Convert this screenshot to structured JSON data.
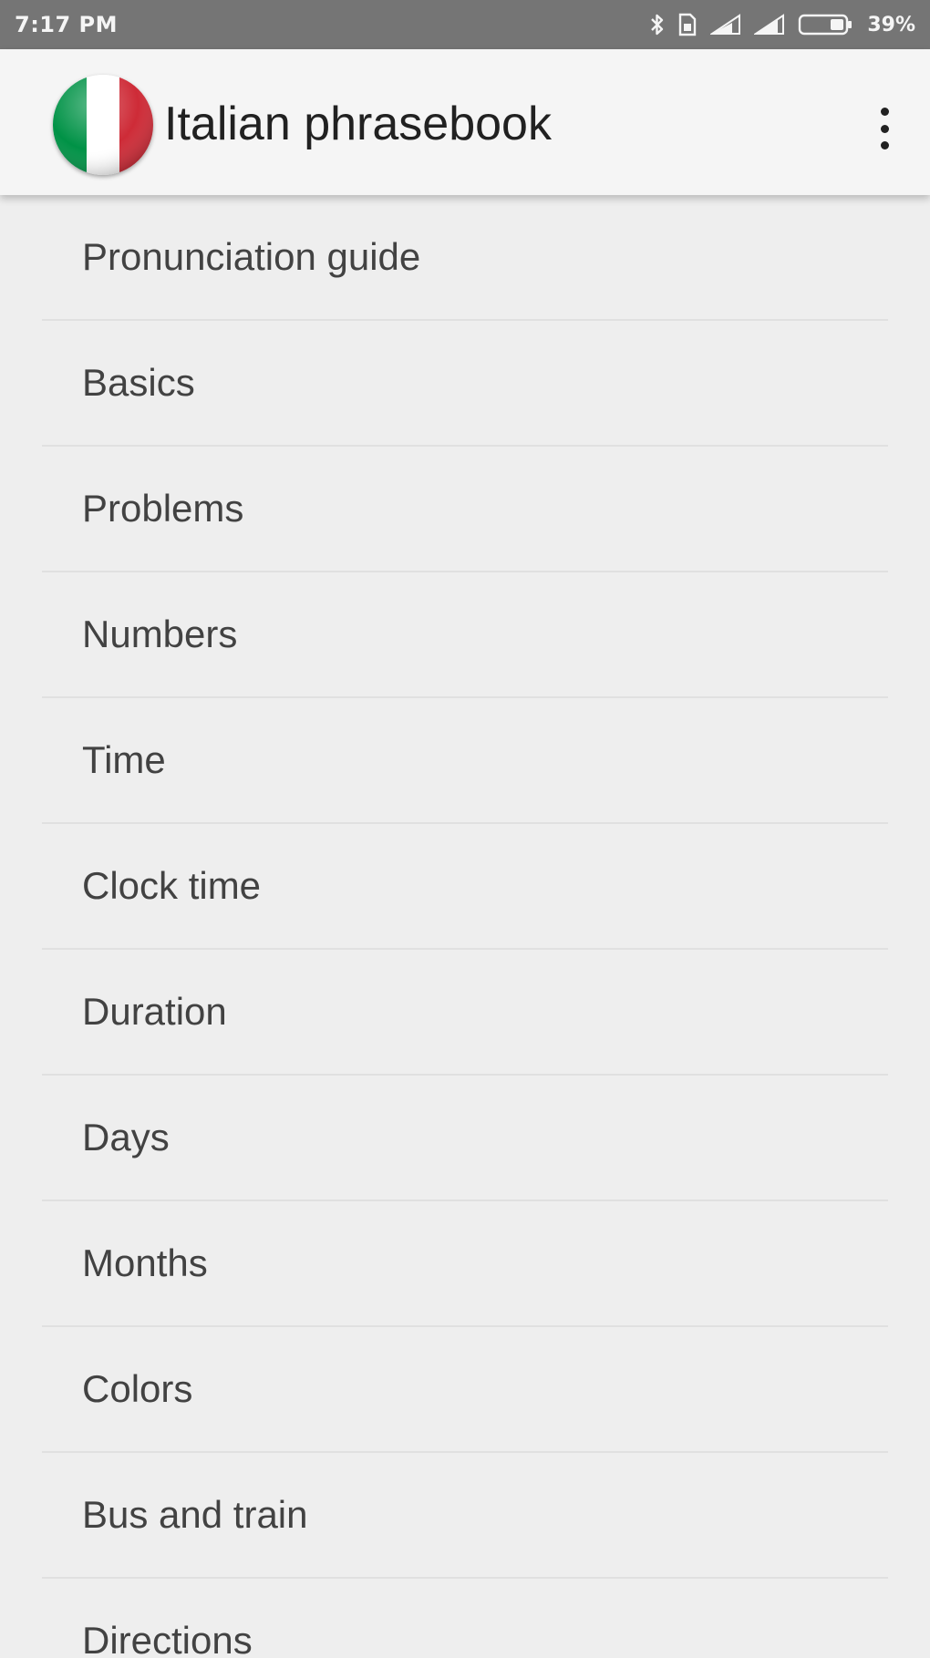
{
  "status_bar": {
    "time": "7:17 PM",
    "battery_percent": "39%",
    "icons": [
      "bluetooth-icon",
      "sim-icon",
      "signal-icon",
      "signal-icon",
      "battery-icon"
    ]
  },
  "app_bar": {
    "title": "Italian phrasebook",
    "logo": "italian-flag-icon",
    "menu_icon": "more-vert-icon"
  },
  "topics": [
    {
      "label": "Pronunciation guide"
    },
    {
      "label": "Basics"
    },
    {
      "label": "Problems"
    },
    {
      "label": "Numbers"
    },
    {
      "label": "Time"
    },
    {
      "label": "Clock time"
    },
    {
      "label": "Duration"
    },
    {
      "label": "Days"
    },
    {
      "label": "Months"
    },
    {
      "label": "Colors"
    },
    {
      "label": "Bus and train"
    },
    {
      "label": "Directions"
    }
  ],
  "colors": {
    "status_bar": "#757575",
    "app_bar": "#f5f5f5",
    "background": "#eeeeee",
    "flag_green": "#009246",
    "flag_white": "#ffffff",
    "flag_red": "#ce2b37"
  }
}
